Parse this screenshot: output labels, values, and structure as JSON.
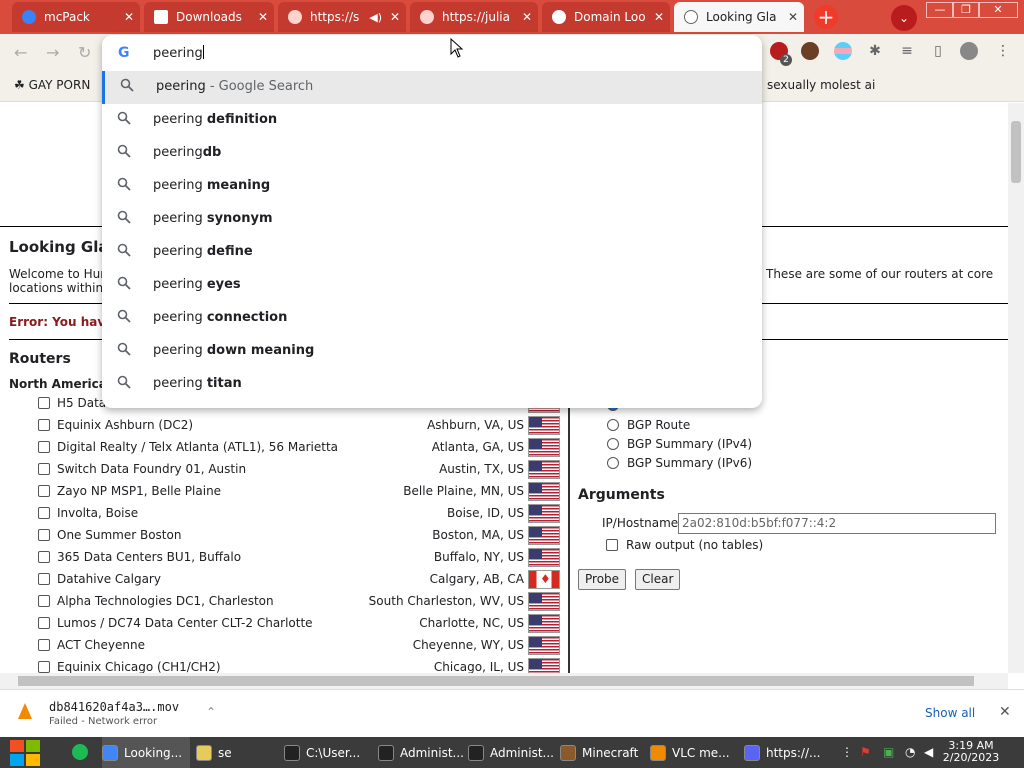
{
  "tabs": [
    {
      "label": "mcPack",
      "active": false
    },
    {
      "label": "Downloads",
      "active": false
    },
    {
      "label": "https://s",
      "active": false
    },
    {
      "label": "https://julia",
      "active": false
    },
    {
      "label": "Domain Loo",
      "active": false
    },
    {
      "label": "Looking Gla",
      "active": true
    }
  ],
  "window": {
    "new_tab": "+",
    "menu": "⌄",
    "minimize": "—",
    "restore": "❐",
    "close": "✕"
  },
  "toolbar": {
    "back": "←",
    "forward": "→",
    "reload": "↻",
    "ext_badge": "2"
  },
  "bookmarks": [
    {
      "label": "GAY PORN"
    },
    {
      "label": "sexually molest ai"
    }
  ],
  "omnibox": {
    "input": "peering",
    "suggestions": [
      {
        "prefix": "peering",
        "rest": " - Google Search",
        "style": "gray"
      },
      {
        "prefix": "peering ",
        "rest": "definition",
        "style": "bold"
      },
      {
        "prefix": "peering",
        "rest": "db",
        "style": "bold"
      },
      {
        "prefix": "peering ",
        "rest": "meaning",
        "style": "bold"
      },
      {
        "prefix": "peering ",
        "rest": "synonym",
        "style": "bold"
      },
      {
        "prefix": "peering ",
        "rest": "define",
        "style": "bold"
      },
      {
        "prefix": "peering ",
        "rest": "eyes",
        "style": "bold"
      },
      {
        "prefix": "peering ",
        "rest": "connection",
        "style": "bold"
      },
      {
        "prefix": "peering ",
        "rest": "down meaning",
        "style": "bold"
      },
      {
        "prefix": "peering ",
        "rest": "titan",
        "style": "bold"
      }
    ]
  },
  "page": {
    "title": "Looking Gla",
    "welcome_start": "Welcome to Hurri",
    "welcome_cont": "locations within o",
    "welcome_right": "These are some of our routers at core",
    "error": "Error: You have",
    "routers_heading": "Routers",
    "region": "North America",
    "routers": [
      {
        "name": "H5 Data",
        "location": "",
        "flag": "us"
      },
      {
        "name": "Equinix Ashburn (DC2)",
        "location": "Ashburn, VA, US",
        "flag": "us"
      },
      {
        "name": "Digital Realty / Telx Atlanta (ATL1), 56 Marietta",
        "location": "Atlanta, GA, US",
        "flag": "us"
      },
      {
        "name": "Switch Data Foundry 01, Austin",
        "location": "Austin, TX, US",
        "flag": "us"
      },
      {
        "name": "Zayo NP MSP1, Belle Plaine",
        "location": "Belle Plaine, MN, US",
        "flag": "us"
      },
      {
        "name": "Involta, Boise",
        "location": "Boise, ID, US",
        "flag": "us"
      },
      {
        "name": "One Summer Boston",
        "location": "Boston, MA, US",
        "flag": "us"
      },
      {
        "name": "365 Data Centers BU1, Buffalo",
        "location": "Buffalo, NY, US",
        "flag": "us"
      },
      {
        "name": "Datahive Calgary",
        "location": "Calgary, AB, CA",
        "flag": "ca"
      },
      {
        "name": "Alpha Technologies DC1, Charleston",
        "location": "South Charleston, WV, US",
        "flag": "us"
      },
      {
        "name": "Lumos / DC74 Data Center CLT-2 Charlotte",
        "location": "Charlotte, NC, US",
        "flag": "us"
      },
      {
        "name": "ACT Cheyenne",
        "location": "Cheyenne, WY, US",
        "flag": "us"
      },
      {
        "name": "Equinix Chicago (CH1/CH2)",
        "location": "Chicago, IL, US",
        "flag": "us"
      }
    ],
    "queries": [
      {
        "label": "BGP Route"
      },
      {
        "label": "BGP Summary (IPv4)"
      },
      {
        "label": "BGP Summary (IPv6)"
      }
    ],
    "arguments_heading": "Arguments",
    "ip_label": "IP/Hostname:",
    "ip_value": "2a02:810d:b5bf:f077::4:2",
    "raw_output": "Raw output (no tables)",
    "probe": "Probe",
    "clear": "Clear"
  },
  "download": {
    "filename": "db841620af4a3….mov",
    "status": "Failed - Network error",
    "show_all": "Show all",
    "close": "✕",
    "chevron": "⌃"
  },
  "taskbar": {
    "items": [
      {
        "label": "Looking...",
        "color": "#4285f4"
      },
      {
        "label": "se",
        "color": "#e8c95c"
      },
      {
        "label": "C:\\User...",
        "color": "#222"
      },
      {
        "label": "Administ...",
        "color": "#222"
      },
      {
        "label": "Administ...",
        "color": "#222"
      },
      {
        "label": "Minecraft",
        "color": "#8b5a2b"
      },
      {
        "label": "VLC me...",
        "color": "#f08a00"
      },
      {
        "label": "https://...",
        "color": "#5865f2"
      }
    ],
    "time": "3:19 AM",
    "date": "2/20/2023"
  }
}
